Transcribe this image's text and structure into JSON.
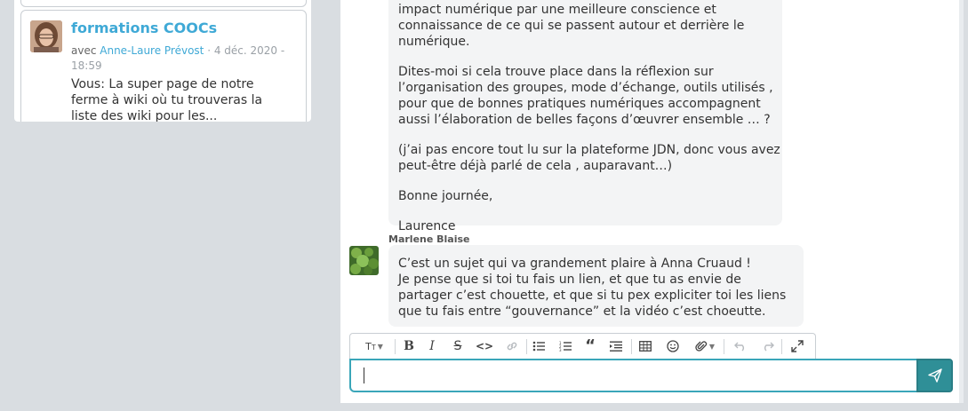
{
  "sidebar": {
    "conversation": {
      "title": "formations COOCs",
      "with_label": "avec",
      "with_name": "Anne-Laure Prévost",
      "date": " · 4 déc. 2020 - 18:59",
      "snippet": "Vous: La super page de notre ferme à wiki où tu trouveras la liste des wiki pour les..."
    }
  },
  "chat": {
    "messages": [
      {
        "paragraphs": [
          "impact numérique par une meilleure conscience et connaissance de ce qui se passent autour et derrière le numérique.",
          "Dites-moi si cela trouve place dans la réflexion sur l’organisation des groupes, mode d’échange, outils utilisés , pour que de bonnes pratiques numériques accompagnent aussi l’élaboration de belles façons d’œuvrer ensemble … ?",
          "(j’ai pas encore tout lu sur la plateforme JDN, donc vous avez peut-être déjà parlé de cela , auparavant…)",
          "Bonne journée,",
          "Laurence"
        ]
      },
      {
        "author": "Marlene Blaise",
        "lines": [
          "C’est un sujet qui va grandement plaire à Anna Cruaud !",
          "Je pense que si toi tu fais un lien, et que tu as envie de partager c’est chouette, et que si tu pex expliciter toi les liens que tu fais entre “gouvernance” et la vidéo c’est choeutte."
        ]
      }
    ]
  },
  "composer": {
    "value": "",
    "placeholder": ""
  },
  "colors": {
    "accent": "#3fa9d6",
    "send": "#2f8f97",
    "input_border": "#3aa6b9"
  }
}
